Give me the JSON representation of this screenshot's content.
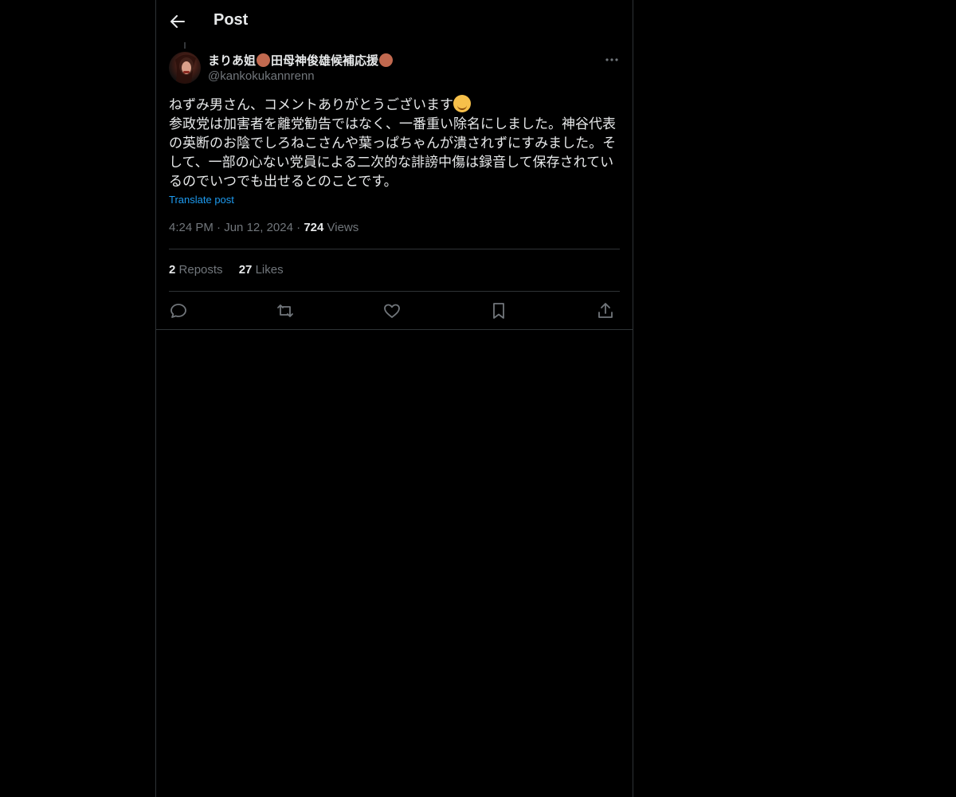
{
  "header": {
    "title": "Post",
    "back_icon": "arrow-left-icon"
  },
  "author": {
    "name_prefix": "まりあ姐",
    "name_middle": "田母神俊雄候補応援",
    "handle": "@kankokukannrenn",
    "avatar": "avatar-photo"
  },
  "post": {
    "line1": "ねずみ男さん、コメントありがとうございます",
    "line2": "参政党は加害者を離党勧告ではなく、一番重い除名にしました。神谷代表の英断のお陰でしろねこさんや葉っぱちゃんが潰されずにすみました。そして、一部の心ない党員による二次的な誹謗中傷は録音して保存されているのでいつでも出せるとのことです。",
    "translate_label": "Translate post"
  },
  "meta": {
    "time": "4:24 PM",
    "separator": "·",
    "date": "Jun 12, 2024",
    "views_count": "724",
    "views_label": "Views"
  },
  "stats": {
    "reposts_count": "2",
    "reposts_label": "Reposts",
    "likes_count": "27",
    "likes_label": "Likes"
  },
  "actions": [
    "reply-icon",
    "repost-icon",
    "like-icon",
    "bookmark-icon",
    "share-icon"
  ],
  "colors": {
    "background": "#000000",
    "text": "#e7e9ea",
    "muted": "#71767b",
    "link": "#1d9bf0",
    "border": "#2f3336",
    "name_dot": "#c1694f"
  }
}
